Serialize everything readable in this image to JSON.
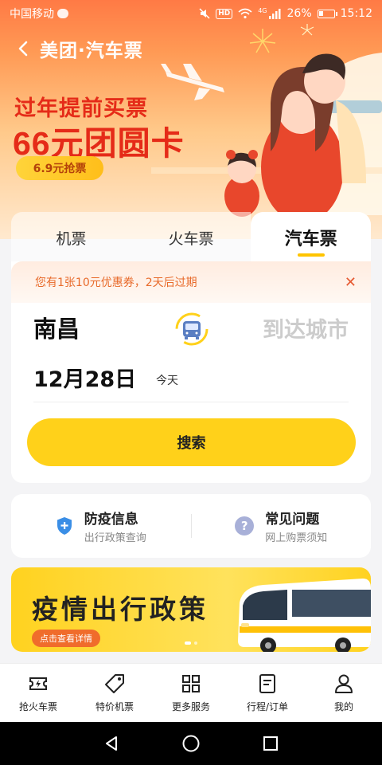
{
  "status": {
    "carrier": "中国移动",
    "network": "4G",
    "battery": "26%",
    "time": "15:12",
    "hd": "HD"
  },
  "header": {
    "title": "美团·汽车票"
  },
  "promo": {
    "line1": "过年提前买票",
    "line2": "66元团圆卡",
    "button": "6.9元抢票"
  },
  "tabs": [
    {
      "label": "机票"
    },
    {
      "label": "火车票"
    },
    {
      "label": "汽车票",
      "active": true
    }
  ],
  "coupon": {
    "text": "您有1张10元优惠券，2天后过期",
    "close": "✕"
  },
  "route": {
    "from": "南昌",
    "to_placeholder": "到达城市"
  },
  "date": {
    "value": "12月28日",
    "sub": "今天"
  },
  "search": {
    "label": "搜索"
  },
  "info": [
    {
      "title": "防疫信息",
      "sub": "出行政策查询",
      "icon": "shield-plus-icon"
    },
    {
      "title": "常见问题",
      "sub": "网上购票须知",
      "icon": "question-icon"
    }
  ],
  "banner": {
    "title": "疫情出行政策",
    "button": "点击查看详情"
  },
  "bottom_nav": [
    {
      "label": "抢火车票",
      "icon": "ticket-bolt-icon"
    },
    {
      "label": "特价机票",
      "icon": "price-tag-icon"
    },
    {
      "label": "更多服务",
      "icon": "grid-icon"
    },
    {
      "label": "行程/订单",
      "icon": "document-icon"
    },
    {
      "label": "我的",
      "icon": "user-icon"
    }
  ],
  "colors": {
    "accent": "#ffd11a",
    "promo_red": "#e52b18",
    "coupon_orange": "#e86a2a"
  }
}
